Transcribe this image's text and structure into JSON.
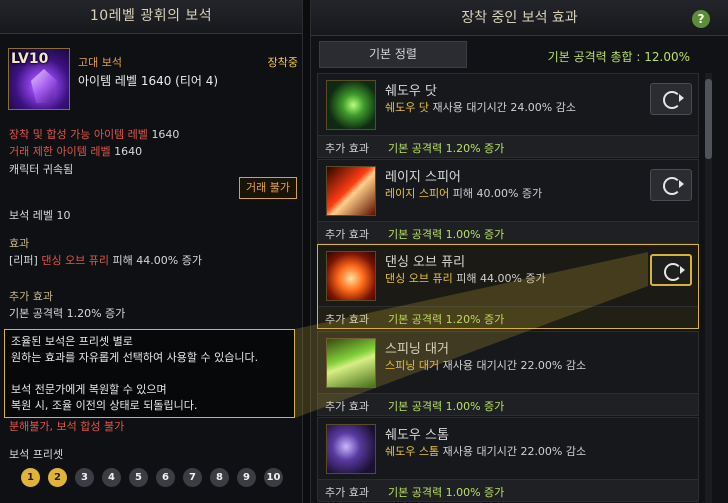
{
  "left": {
    "title": "10레벨 광휘의 보석",
    "gem_level_badge": "LV10",
    "grade": "고대 보석",
    "equip_status": "장착중",
    "item_level": "아이템 레벨 1640 (티어 4)",
    "req_line1_label": "장착 및 합성 가능 아이템 레벨",
    "req_line1_value": "1640",
    "req_line2_label": "거래 제한 아이템 레벨",
    "req_line2_value": "1640",
    "bound": "캐릭터 귀속됨",
    "trade_button": "거래 불가",
    "gem_level": "보석 레벨 10",
    "effect_title": "효과",
    "effect_class": "[리퍼]",
    "effect_skill": "댄싱 오브 퓨리",
    "effect_text": "피해 44.00% 증가",
    "extra_title": "추가 효과",
    "extra_text": "기본 공격력 1.20% 증가",
    "desc_lines": [
      "조율된 보석은 프리셋 별로",
      "원하는 효과를 자유롭게 선택하여 사용할 수 있습니다.",
      "",
      "보석 전문가에게 복원할 수 있으며",
      "복원 시, 조율 이전의 상태로 되돌립니다."
    ],
    "restriction": "분해불가, 보석 합성 불가",
    "preset_title": "보석 프리셋",
    "presets": [
      "1",
      "2",
      "3",
      "4",
      "5",
      "6",
      "7",
      "8",
      "9",
      "10"
    ]
  },
  "right": {
    "title": "장착 중인 보석 효과",
    "help": "?",
    "sort_tab": "기본 정렬",
    "total_label": "기본 공격력 총합 : 12.00%",
    "bonus_label": "추가 효과",
    "effects": [
      {
        "name": "쉐도우 닷",
        "skill": "쉐도우 닷",
        "desc": "재사용 대기시간 24.00% 감소",
        "bonus": "기본 공격력 1.20% 증가",
        "icon": "shadow-dot-icon"
      },
      {
        "name": "레이지 스피어",
        "skill": "레이지 스피어",
        "desc": "피해 40.00% 증가",
        "bonus": "기본 공격력 1.00% 증가",
        "icon": "rage-spear-icon"
      },
      {
        "name": "댄싱 오브 퓨리",
        "skill": "댄싱 오브 퓨리",
        "desc": "피해 44.00% 증가",
        "bonus": "기본 공격력 1.20% 증가",
        "icon": "dancing-of-fury-icon"
      },
      {
        "name": "스피닝 대거",
        "skill": "스피닝 대거",
        "desc": "재사용 대기시간 22.00% 감소",
        "bonus": "기본 공격력 1.00% 증가",
        "icon": "spinning-dagger-icon"
      },
      {
        "name": "쉐도우 스톰",
        "skill": "쉐도우 스톰",
        "desc": "재사용 대기시간 22.00% 감소",
        "bonus": "기본 공격력 1.00% 증가",
        "icon": "shadow-storm-icon"
      }
    ]
  }
}
